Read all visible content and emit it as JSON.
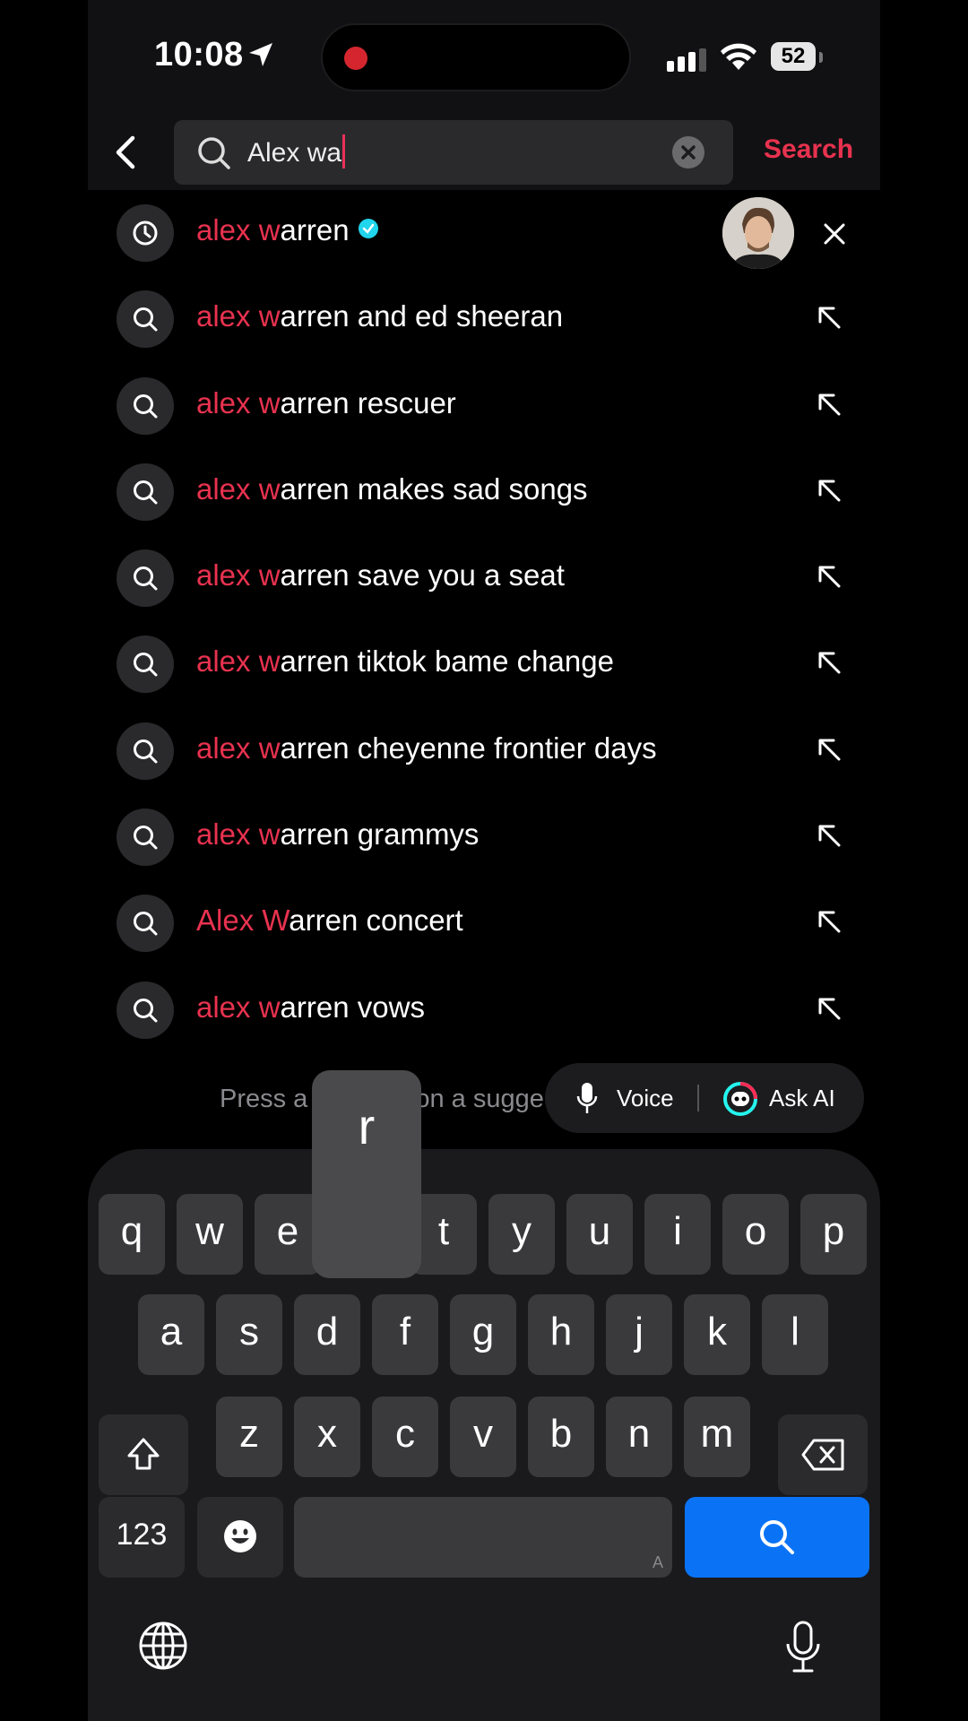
{
  "status_bar": {
    "time": "10:08",
    "battery": "52"
  },
  "search": {
    "query": "Alex wa",
    "action_label": "Search"
  },
  "suggestions": [
    {
      "icon": "history-icon",
      "highlight": "alex w",
      "rest": "arren",
      "verified": true,
      "has_avatar": true,
      "trailing": "close-icon"
    },
    {
      "icon": "search-icon",
      "highlight": "alex w",
      "rest": "arren and ed sheeran",
      "trailing": "fill-arrow-icon"
    },
    {
      "icon": "search-icon",
      "highlight": "alex w",
      "rest": "arren rescuer",
      "trailing": "fill-arrow-icon"
    },
    {
      "icon": "search-icon",
      "highlight": "alex w",
      "rest": "arren makes sad songs",
      "trailing": "fill-arrow-icon"
    },
    {
      "icon": "search-icon",
      "highlight": "alex w",
      "rest": "arren save you a seat",
      "trailing": "fill-arrow-icon"
    },
    {
      "icon": "search-icon",
      "highlight": "alex w",
      "rest": "arren tiktok bame change",
      "trailing": "fill-arrow-icon"
    },
    {
      "icon": "search-icon",
      "highlight": "alex w",
      "rest": "arren cheyenne frontier days",
      "trailing": "fill-arrow-icon"
    },
    {
      "icon": "search-icon",
      "highlight": "alex w",
      "rest": "arren grammys",
      "trailing": "fill-arrow-icon"
    },
    {
      "icon": "search-icon",
      "highlight": "Alex W",
      "rest": "arren concert",
      "trailing": "fill-arrow-icon"
    },
    {
      "icon": "search-icon",
      "highlight": "alex w",
      "rest": "arren vows",
      "trailing": "fill-arrow-icon"
    }
  ],
  "hint_text": "Press and hold on a suggestion",
  "hint_visible": [
    "Press a",
    "on a sugge"
  ],
  "pill": {
    "voice_label": "Voice",
    "ask_ai_label": "Ask AI"
  },
  "keyboard": {
    "popup_key": "r",
    "row1": [
      "q",
      "w",
      "e",
      "r",
      "t",
      "y",
      "u",
      "i",
      "o",
      "p"
    ],
    "row2": [
      "a",
      "s",
      "d",
      "f",
      "g",
      "h",
      "j",
      "k",
      "l"
    ],
    "row3": [
      "z",
      "x",
      "c",
      "v",
      "b",
      "n",
      "m"
    ],
    "numbers_label": "123",
    "space_hint": "A"
  },
  "colors": {
    "accent": "#e8324f",
    "keyboard_go": "#0a73f5",
    "verified": "#20d5ec"
  }
}
